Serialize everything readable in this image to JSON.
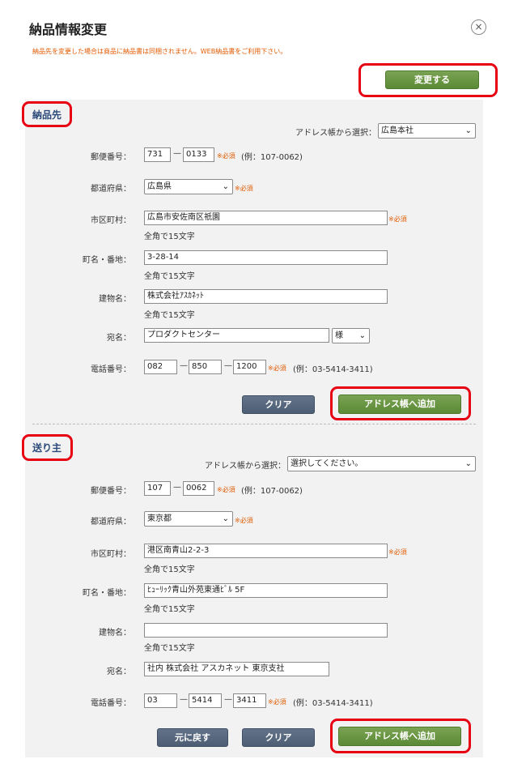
{
  "dialog": {
    "title": "納品情報変更",
    "close_icon": "×",
    "notice": "納品先を変更した場合は商品に納品書は同梱されません。WEB納品書をご利用下さい。",
    "change_button": "変更する"
  },
  "common": {
    "required": "※必須",
    "hyphen": "—",
    "hint_15": "全角で15文字",
    "chevron": "⌄"
  },
  "delivery": {
    "section_label": "納品先",
    "addressbook_label": "アドレス帳から選択：",
    "addressbook_value": "広島本社",
    "postal_label": "郵便番号：",
    "postal1": "731",
    "postal2": "0133",
    "postal_example": "(例：107-0062)",
    "prefecture_label": "都道府県：",
    "prefecture_value": "広島県",
    "city_label": "市区町村：",
    "city_value": "広島市安佐南区祇園",
    "town_label": "町名・番地：",
    "town_value": "3-28-14",
    "building_label": "建物名：",
    "building_value": "株式会社ｱｽｶﾈｯﾄ",
    "recipient_label": "宛名：",
    "recipient_value": "プロダクトセンター",
    "honorific_value": "様",
    "phone_label": "電話番号：",
    "phone1": "082",
    "phone2": "850",
    "phone3": "1200",
    "phone_example": "(例：03-5414-3411)",
    "clear_button": "クリア",
    "add_button": "アドレス帳へ追加"
  },
  "sender": {
    "section_label": "送り主",
    "addressbook_label": "アドレス帳から選択：",
    "addressbook_value": "選択してください。",
    "postal_label": "郵便番号：",
    "postal1": "107",
    "postal2": "0062",
    "postal_example": "(例：107-0062)",
    "prefecture_label": "都道府県：",
    "prefecture_value": "東京都",
    "city_label": "市区町村：",
    "city_value": "港区南青山2-2-3",
    "town_label": "町名・番地：",
    "town_value": "ﾋｭｰﾘｯｸ青山外苑東通ﾋﾞﾙ 5F",
    "building_label": "建物名：",
    "building_value": "",
    "recipient_label": "宛名：",
    "recipient_value": "社内 株式会社 アスカネット 東京支社",
    "phone_label": "電話番号：",
    "phone1": "03",
    "phone2": "5414",
    "phone3": "3411",
    "phone_example": "(例：03-5414-3411)",
    "back_button": "元に戻す",
    "clear_button": "クリア",
    "add_button": "アドレス帳へ追加"
  }
}
